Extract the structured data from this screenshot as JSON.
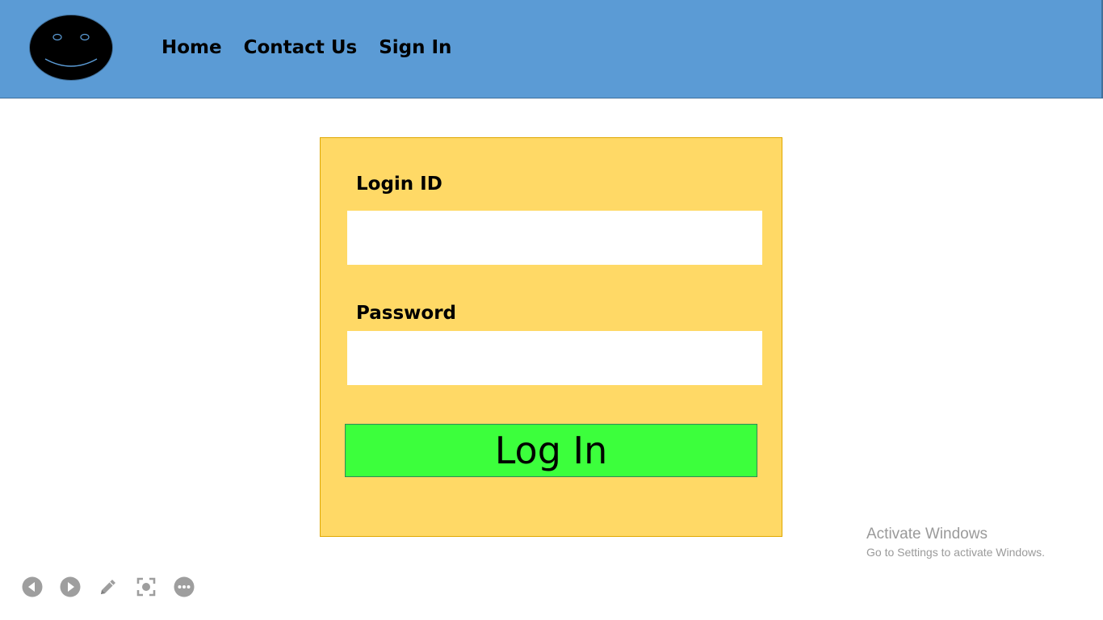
{
  "header": {
    "nav": {
      "home": "Home",
      "contact": "Contact Us",
      "signin": "Sign In"
    }
  },
  "login": {
    "login_id_label": "Login ID",
    "login_id_value": "",
    "password_label": "Password",
    "password_value": "",
    "button_label": "Log In"
  },
  "watermark": {
    "title": "Activate Windows",
    "subtitle": "Go to Settings to activate Windows."
  },
  "toolbar": {
    "icons": [
      "previous-icon",
      "next-icon",
      "pen-icon",
      "focus-icon",
      "more-icon"
    ]
  },
  "colors": {
    "header": "#5b9bd5",
    "panel": "#ffd966",
    "button": "#3cff3c",
    "toolbar_icon": "#9e9e9e"
  }
}
